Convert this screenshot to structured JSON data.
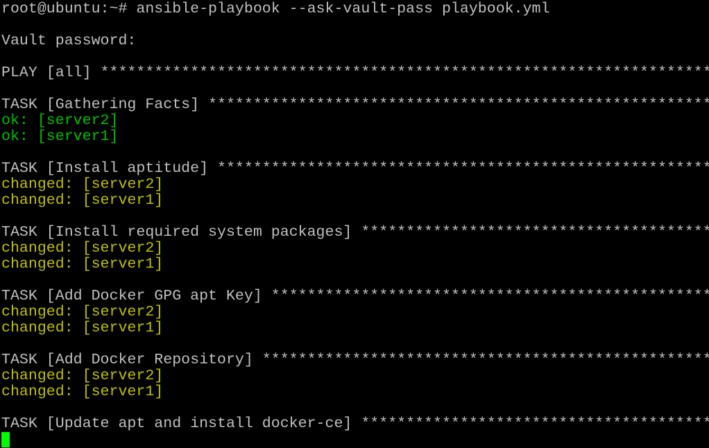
{
  "terminal": {
    "prompt": "root@ubuntu:~# ",
    "command": "ansible-playbook --ask-vault-pass playbook.yml",
    "cursor_color": "#00ff00",
    "colors": {
      "default": "#c0c0c0",
      "ok": "#00c000",
      "changed": "#c0c000",
      "background": "#000000"
    },
    "lines": [
      {
        "text": "root@ubuntu:~# ansible-playbook --ask-vault-pass playbook.yml",
        "kind": "default"
      },
      {
        "text": "",
        "kind": "default"
      },
      {
        "text": "Vault password:",
        "kind": "default"
      },
      {
        "text": "",
        "kind": "default"
      },
      {
        "text": "PLAY [all] ******************************************************************************",
        "kind": "default"
      },
      {
        "text": "",
        "kind": "default"
      },
      {
        "text": "TASK [Gathering Facts] ******************************************************************",
        "kind": "default"
      },
      {
        "text": "ok: [server2]",
        "kind": "ok"
      },
      {
        "text": "ok: [server1]",
        "kind": "ok"
      },
      {
        "text": "",
        "kind": "default"
      },
      {
        "text": "TASK [Install aptitude] *****************************************************************",
        "kind": "default"
      },
      {
        "text": "changed: [server2]",
        "kind": "changed"
      },
      {
        "text": "changed: [server1]",
        "kind": "changed"
      },
      {
        "text": "",
        "kind": "default"
      },
      {
        "text": "TASK [Install required system packages] *************************************************",
        "kind": "default"
      },
      {
        "text": "changed: [server2]",
        "kind": "changed"
      },
      {
        "text": "changed: [server1]",
        "kind": "changed"
      },
      {
        "text": "",
        "kind": "default"
      },
      {
        "text": "TASK [Add Docker GPG apt Key] ***********************************************************",
        "kind": "default"
      },
      {
        "text": "changed: [server2]",
        "kind": "changed"
      },
      {
        "text": "changed: [server1]",
        "kind": "changed"
      },
      {
        "text": "",
        "kind": "default"
      },
      {
        "text": "TASK [Add Docker Repository] ************************************************************",
        "kind": "default"
      },
      {
        "text": "changed: [server2]",
        "kind": "changed"
      },
      {
        "text": "changed: [server1]",
        "kind": "changed"
      },
      {
        "text": "",
        "kind": "default"
      },
      {
        "text": "TASK [Update apt and install docker-ce] *************************************************",
        "kind": "default"
      }
    ]
  }
}
